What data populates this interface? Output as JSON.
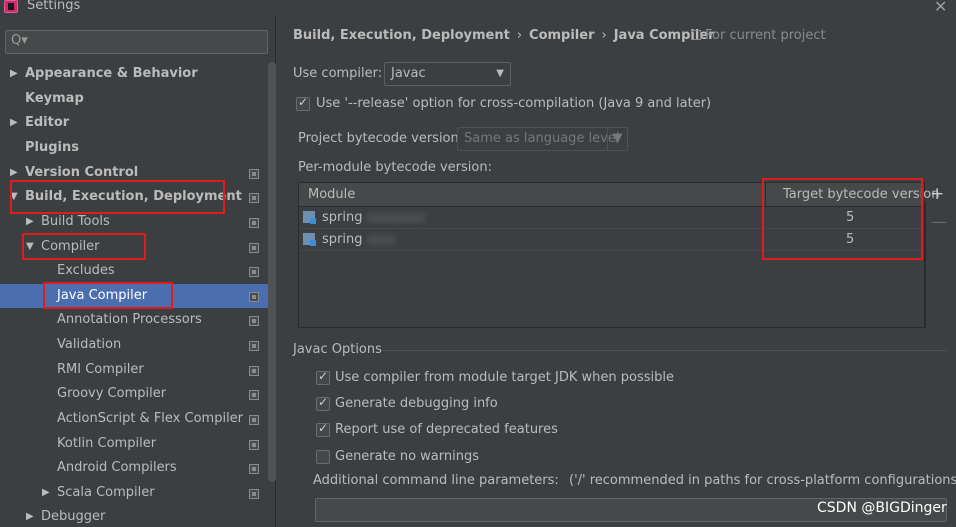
{
  "window": {
    "title": "Settings",
    "close_glyph": "✕"
  },
  "search": {
    "icon": "search-icon",
    "glyph": "Q▾"
  },
  "sidebar": {
    "items": [
      {
        "label": "Appearance & Behavior",
        "arrow": "▶"
      },
      {
        "label": "Keymap",
        "arrow": ""
      },
      {
        "label": "Editor",
        "arrow": "▶"
      },
      {
        "label": "Plugins",
        "arrow": ""
      },
      {
        "label": "Version Control",
        "arrow": "▶"
      },
      {
        "label": "Build, Execution, Deployment",
        "arrow": "▼"
      },
      {
        "label": "Build Tools",
        "arrow": "▶"
      },
      {
        "label": "Compiler",
        "arrow": "▼"
      },
      {
        "label": "Excludes",
        "arrow": ""
      },
      {
        "label": "Java Compiler",
        "arrow": ""
      },
      {
        "label": "Annotation Processors",
        "arrow": ""
      },
      {
        "label": "Validation",
        "arrow": ""
      },
      {
        "label": "RMI Compiler",
        "arrow": ""
      },
      {
        "label": "Groovy Compiler",
        "arrow": ""
      },
      {
        "label": "ActionScript & Flex Compiler",
        "arrow": ""
      },
      {
        "label": "Kotlin Compiler",
        "arrow": ""
      },
      {
        "label": "Android Compilers",
        "arrow": ""
      },
      {
        "label": "Scala Compiler",
        "arrow": "▶"
      },
      {
        "label": "Debugger",
        "arrow": "▶"
      }
    ],
    "selected": "Java Compiler"
  },
  "breadcrumb": {
    "parts": [
      "Build, Execution, Deployment",
      "Compiler",
      "Java Compiler"
    ],
    "separator": "›",
    "scope": "For current project"
  },
  "compiler": {
    "use_compiler_label": "Use compiler:",
    "use_compiler_value": "Javac",
    "release_option_label": "Use '--release' option for cross-compilation (Java 9 and later)",
    "release_option_checked": true,
    "project_bytecode_label": "Project bytecode version:",
    "project_bytecode_value": "Same as language level",
    "per_module_label": "Per-module bytecode version:"
  },
  "module_table": {
    "headers": [
      "Module",
      "Target bytecode version"
    ],
    "rows": [
      {
        "module": "spring",
        "target": "5"
      },
      {
        "module": "spring",
        "target": "5"
      }
    ],
    "add_glyph": "+",
    "remove_glyph": "—"
  },
  "javac_options": {
    "title": "Javac Options",
    "options": [
      {
        "label": "Use compiler from module target JDK when possible",
        "checked": true
      },
      {
        "label": "Generate debugging info",
        "checked": true
      },
      {
        "label": "Report use of deprecated features",
        "checked": true
      },
      {
        "label": "Generate no warnings",
        "checked": false
      }
    ],
    "additional_params_label": "Additional command line parameters:",
    "additional_params_hint": "('/' recommended in paths for cross-platform configurations)",
    "additional_params_value": ""
  },
  "watermark": "CSDN @BIGDinger",
  "colors": {
    "selection": "#4b6eaf",
    "annotation_red": "#e01b1b",
    "background": "#3c3f41"
  }
}
